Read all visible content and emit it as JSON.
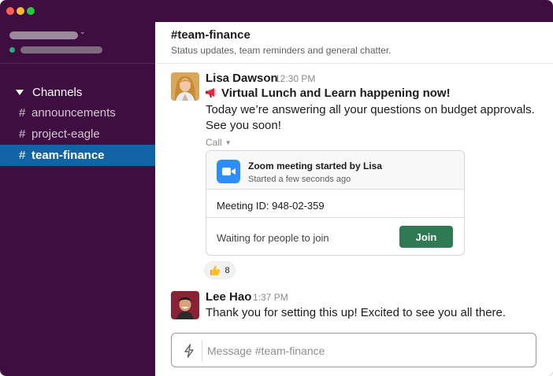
{
  "window": {
    "traffic_lights": [
      "#ff5f57",
      "#febc2e",
      "#28c840"
    ]
  },
  "sidebar": {
    "channels_label": "Channels",
    "items": [
      {
        "hash": "#",
        "label": "announcements",
        "active": false
      },
      {
        "hash": "#",
        "label": "project-eagle",
        "active": false
      },
      {
        "hash": "#",
        "label": "team-finance",
        "active": true
      }
    ],
    "colors": {
      "background": "#3f0e40",
      "active": "#1164a3",
      "presence": "#2bac76"
    }
  },
  "channel": {
    "title": "#team-finance",
    "topic": "Status updates, team reminders and general chatter."
  },
  "messages": [
    {
      "author": "Lisa Dawson",
      "time": "12:30 PM",
      "lines": [
        "Virtual Lunch and Learn happening now!",
        "Today we’re answering all your questions on budget approvals.",
        "See you soon!"
      ],
      "call": {
        "label": "Call",
        "title": "Zoom meeting started by Lisa",
        "subtitle": "Started a few seconds ago",
        "meeting_id": "Meeting ID: 948-02-359",
        "status": "Waiting for people to join",
        "join_label": "Join"
      },
      "reaction": {
        "icon": "thumbs-up-icon",
        "count": "8"
      }
    },
    {
      "author": "Lee Hao",
      "time": "1:37 PM",
      "lines": [
        "Thank you for setting this up! Excited to see you all there."
      ]
    }
  ],
  "composer": {
    "placeholder": "Message #team-finance"
  }
}
